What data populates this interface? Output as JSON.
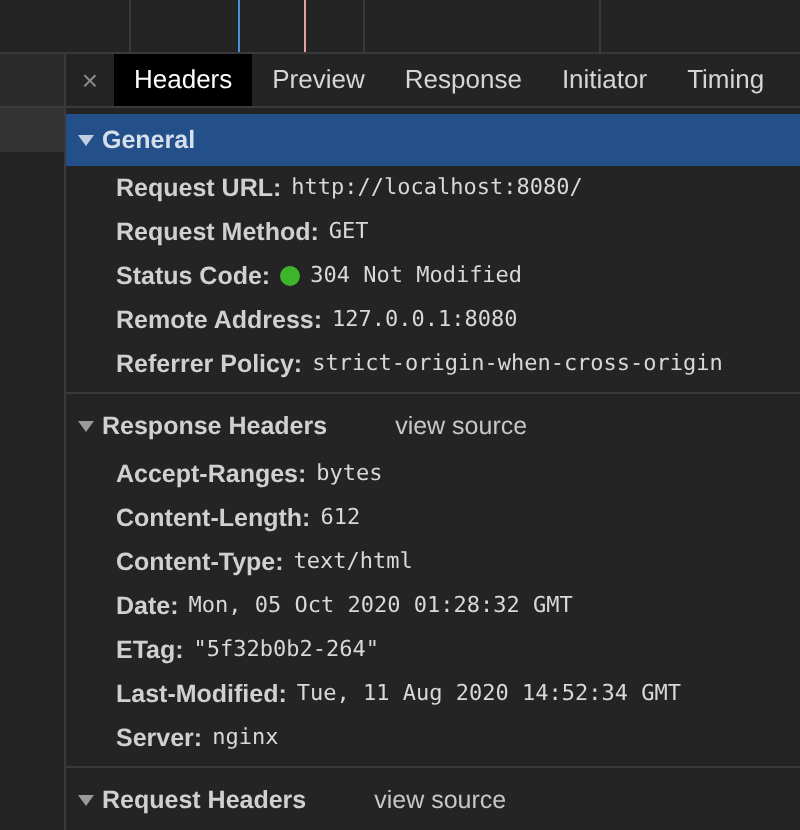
{
  "tabs": [
    {
      "label": "Headers",
      "selected": true
    },
    {
      "label": "Preview",
      "selected": false
    },
    {
      "label": "Response",
      "selected": false
    },
    {
      "label": "Initiator",
      "selected": false
    },
    {
      "label": "Timing",
      "selected": false
    }
  ],
  "close_label": "×",
  "sections": [
    {
      "title": "General",
      "expanded": true,
      "selected": true,
      "rows": [
        {
          "name": "Request URL:",
          "value": "http://localhost:8080/"
        },
        {
          "name": "Request Method:",
          "value": "GET"
        },
        {
          "name": "Status Code:",
          "value": "304 Not Modified",
          "color": "#3db42a"
        },
        {
          "name": "Remote Address:",
          "value": "127.0.0.1:8080"
        },
        {
          "name": "Referrer Policy:",
          "value": "strict-origin-when-cross-origin"
        }
      ]
    },
    {
      "title": "Response Headers",
      "link": "view source",
      "expanded": true,
      "selected": false,
      "rows": [
        {
          "name": "Accept-Ranges:",
          "value": "bytes"
        },
        {
          "name": "Content-Length:",
          "value": "612"
        },
        {
          "name": "Content-Type:",
          "value": "text/html"
        },
        {
          "name": "Date:",
          "value": "Mon, 05 Oct 2020 01:28:32 GMT"
        },
        {
          "name": "ETag:",
          "value": "\"5f32b0b2-264\""
        },
        {
          "name": "Last-Modified:",
          "value": "Tue, 11 Aug 2020 14:52:34 GMT"
        },
        {
          "name": "Server:",
          "value": "nginx"
        }
      ]
    },
    {
      "title": "Request Headers",
      "link": "view source",
      "expanded": true,
      "selected": false
    }
  ]
}
